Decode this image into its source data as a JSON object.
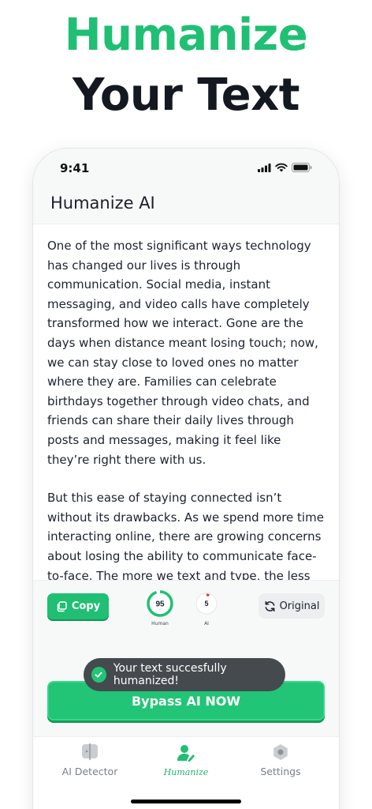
{
  "hero": {
    "line1": "Humanize",
    "line2": "Your Text"
  },
  "status_bar": {
    "time": "9:41"
  },
  "header": {
    "title": "Humanize AI"
  },
  "content": {
    "paragraphs": [
      "One of the most significant ways technology has changed our lives is through communication. Social media, instant messaging, and video calls have completely transformed how we interact. Gone are the days when distance meant losing touch; now, we can stay close to loved ones no matter where they are. Families can celebrate birthdays together through video chats, and friends can share their daily lives through posts and messages, making it feel like they’re right there with us.",
      "But this ease of staying connected isn’t without its drawbacks. As we spend more time interacting online, there are growing concerns about losing the ability to communicate face-to-face. The more we text and type, the less we practice these in-person conversation skills."
    ]
  },
  "actions": {
    "copy_label": "Copy",
    "original_label": "Original"
  },
  "scores": {
    "human": {
      "value": "95",
      "label": "Human",
      "fraction": 0.95
    },
    "ai": {
      "value": "5",
      "label": "AI",
      "fraction": 0.05
    }
  },
  "toast": {
    "message": "Your text succesfully humanized!"
  },
  "cta": {
    "label": "Bypass AI NOW"
  },
  "tabs": [
    {
      "label": "AI Detector",
      "icon": "scan-icon"
    },
    {
      "label": "Humanize",
      "icon": "user-edit-icon"
    },
    {
      "label": "Settings",
      "icon": "gear-icon"
    }
  ],
  "colors": {
    "accent": "#20bf73",
    "ai_indicator": "#e23b3b",
    "text_dark": "#141821"
  }
}
